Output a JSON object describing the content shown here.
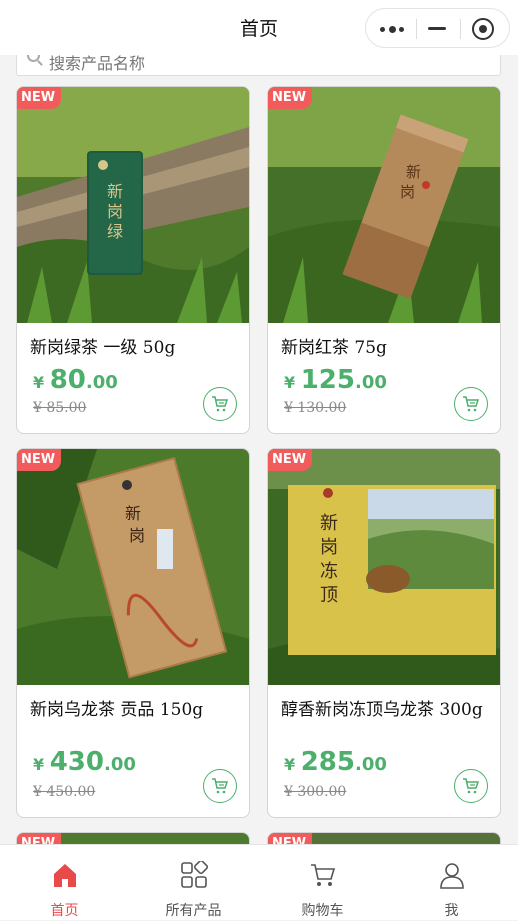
{
  "nav": {
    "title": "首页"
  },
  "search": {
    "placeholder": "搜索产品名称"
  },
  "badge_text": "NEW",
  "currency": "¥",
  "products": [
    {
      "name": "新岗绿茶 一级 50g",
      "price_int": "80",
      "price_dec": ".00",
      "orig": "¥ 85.00"
    },
    {
      "name": "新岗红茶 75g",
      "price_int": "125",
      "price_dec": ".00",
      "orig": "¥ 130.00"
    },
    {
      "name": "新岗乌龙茶 贡品 150g",
      "price_int": "430",
      "price_dec": ".00",
      "orig": "¥ 450.00"
    },
    {
      "name": "醇香新岗冻顶乌龙茶 300g",
      "price_int": "285",
      "price_dec": ".00",
      "orig": "¥ 300.00"
    }
  ],
  "tabs": [
    {
      "label": "首页",
      "icon": "home-icon",
      "active": true
    },
    {
      "label": "所有产品",
      "icon": "grid-icon"
    },
    {
      "label": "购物车",
      "icon": "cart-icon"
    },
    {
      "label": "我",
      "icon": "user-icon"
    }
  ],
  "colors": {
    "accent": "#4caf6b",
    "badge": "#f25b5b",
    "active_tab": "#e84a4a"
  }
}
